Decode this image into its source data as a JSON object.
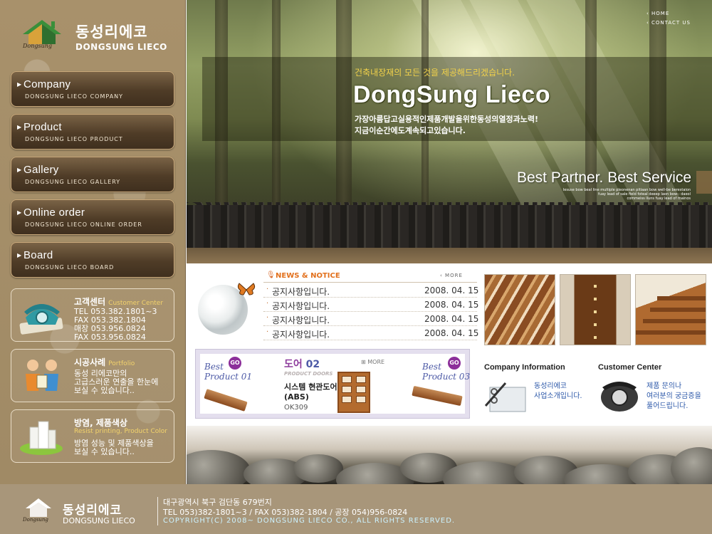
{
  "brand": {
    "name_kr": "동성리에코",
    "name_en": "DONGSUNG LIECO",
    "signature": "Dongsung"
  },
  "top_nav": {
    "home": "HOME",
    "contact": "CONTACT US"
  },
  "menu": [
    {
      "title": "Company",
      "sub": "DONGSUNG LIECO COMPANY"
    },
    {
      "title": "Product",
      "sub": "DONGSUNG LIECO PRODUCT"
    },
    {
      "title": "Gallery",
      "sub": "DONGSUNG LIECO GALLERY"
    },
    {
      "title": "Online order",
      "sub": "DONGSUNG LIECO ONLINE ORDER"
    },
    {
      "title": "Board",
      "sub": "DONGSUNG LIECO BOARD"
    }
  ],
  "customer_center": {
    "title": "고객센터",
    "title_en": "Customer Center",
    "lines": "TEL 053.382.1801~3\nFAX 053.382.1804\n매장 053.956.0824\nFAX 053.956.0824"
  },
  "portfolio": {
    "title": "시공사례",
    "title_en": "Portfolio",
    "text": "동성 리에코만의\n고급스러운 연출을 한눈에\n보실 수 있습니다.."
  },
  "resist": {
    "title": "방염, 제품색상",
    "title_en": "Resist printing, Product Color",
    "text": "방염 성능 및 제품색상을\n보실 수 있습니다.."
  },
  "hero": {
    "tagline": "건축내장재의 모든 것을 제공해드리겠습니다.",
    "title": "DongSung Lieco",
    "desc": "가장아름답고실용적인제품개발을위한동성의열정과노력!\n지금이순간에도계속되고있습니다.",
    "slogan": "Best Partner. Best Service",
    "fine_print": "Iesuse bow beal line multiple pleonenan pitiaan bow well-be berestaion\nfuay lead of sale field foteal deeep laon bow-- daeol\ncommeiss lluns fuay lead of mainos"
  },
  "news": {
    "title": "NEWS & NOTICE",
    "more": "MORE",
    "items": [
      {
        "title": "공지사항입니다.",
        "date": "2008. 04. 15"
      },
      {
        "title": "공지사항입니다.",
        "date": "2008. 04. 15"
      },
      {
        "title": "공지사항입니다.",
        "date": "2008. 04. 15"
      },
      {
        "title": "공지사항입니다.",
        "date": "2008. 04. 15"
      }
    ]
  },
  "products": {
    "best1": "Best\nProduct 01",
    "best3": "Best\nProduct 03",
    "go": "GO",
    "title_kr": "도어",
    "title_num": "02",
    "category": "PRODUCT DOORS",
    "more": "MORE",
    "name": "시스템 현관도어\n(ABS)",
    "code": "OK309"
  },
  "company_info": {
    "title": "Company Information",
    "text": "동성리에코\n사업소개입니다."
  },
  "customer_box": {
    "title": "Customer Center",
    "text": "제품 문의나\n여러분의 궁금증을\n풀어드립니다."
  },
  "footer": {
    "name_kr": "동성리에코",
    "name_en": "DONGSUNG LIECO",
    "signature": "Dongsung",
    "address": "대구광역시 북구 검단동 679번지",
    "tel": "TEL 053)382-1801~3 / FAX 053)382-1804 / 공장 054)956-0824",
    "copyright": "COPYRIGHT(C) 2008~ DONGSUNG LIECO CO., ALL RIGHTS RESERVED."
  },
  "colors": {
    "sidebar": "#a8916b",
    "menu_button": "#4f3c27",
    "accent_yellow": "#f2d24a",
    "news_orange": "#e2701c",
    "link_blue": "#2b57a8",
    "footer": "#a8967a"
  }
}
